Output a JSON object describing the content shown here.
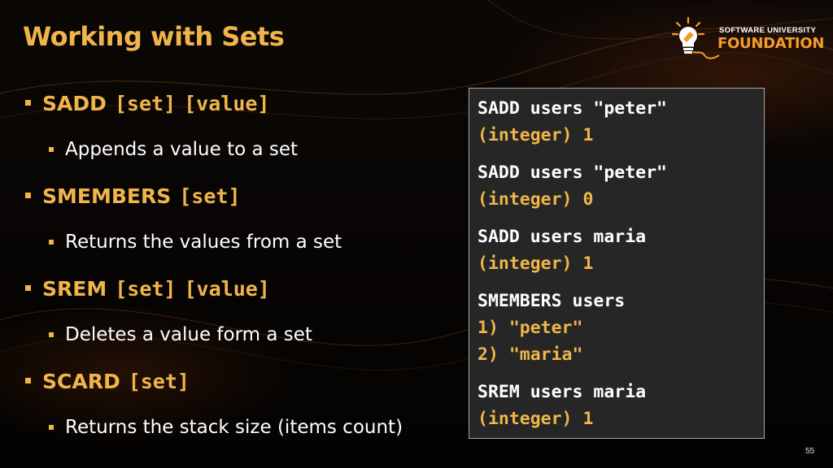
{
  "slide": {
    "title": "Working with Sets",
    "page_number": "55"
  },
  "logo": {
    "line1": "SOFTWARE UNIVERSITY",
    "line2": "FOUNDATION"
  },
  "bullets": [
    {
      "command": "SADD",
      "args": [
        "[set]",
        "[value]"
      ],
      "description": "Appends a value to a set"
    },
    {
      "command": "SMEMBERS",
      "args": [
        "[set]"
      ],
      "description": "Returns the values from a set"
    },
    {
      "command": "SREM",
      "args": [
        "[set]",
        "[value]"
      ],
      "description": "Deletes a value form a set"
    },
    {
      "command": "SCARD",
      "args": [
        "[set]"
      ],
      "description": "Returns the stack size (items count)"
    }
  ],
  "code_panel": {
    "blocks": [
      {
        "command": "SADD users \"peter\"",
        "output": [
          "(integer) 1"
        ]
      },
      {
        "command": "SADD users \"peter\"",
        "output": [
          "(integer) 0"
        ]
      },
      {
        "command": "SADD users maria",
        "output": [
          "(integer) 1"
        ]
      },
      {
        "command": "SMEMBERS users",
        "output": [
          "1) \"peter\"",
          "2) \"maria\""
        ]
      },
      {
        "command": "SREM users maria",
        "output": [
          "(integer) 1"
        ]
      }
    ]
  },
  "colors": {
    "accent": "#f0b54a",
    "logo_orange": "#f39c2a",
    "code_bg": "#262626",
    "text": "#ffffff"
  }
}
